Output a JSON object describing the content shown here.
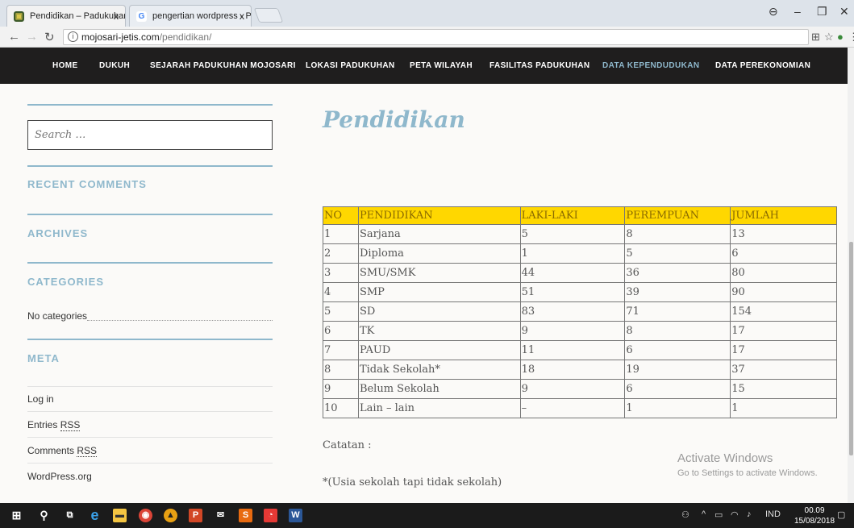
{
  "browser": {
    "tabs": [
      {
        "title": "Pendidikan – Padukuhan",
        "close": "x"
      },
      {
        "title": "pengertian wordpress - P",
        "close": "x"
      }
    ],
    "url_host": "mojosari-jetis.com",
    "url_path": "/pendidikan/"
  },
  "nav": {
    "items": [
      "HOME",
      "DUKUH",
      "SEJARAH PADUKUHAN MOJOSARI",
      "LOKASI PADUKUHAN",
      "PETA WILAYAH",
      "FASILITAS PADUKUHAN",
      "DATA KEPENDUDUKAN",
      "DATA PEREKONOMIAN"
    ],
    "current": "DATA KEPENDUDUKAN"
  },
  "sidebar": {
    "search_placeholder": "Search …",
    "recent_comments_title": "RECENT COMMENTS",
    "archives_title": "ARCHIVES",
    "categories_title": "CATEGORIES",
    "categories_empty": "No categories",
    "meta_title": "META",
    "meta_login": "Log in",
    "meta_entries_prefix": "Entries ",
    "meta_comments_prefix": "Comments ",
    "meta_rss": "RSS",
    "meta_wordpress": "WordPress.org"
  },
  "page": {
    "title": "Pendidikan",
    "table": {
      "headers": [
        "NO",
        "PENDIDIKAN",
        "LAKI-LAKI",
        "PEREMPUAN",
        "JUMLAH"
      ],
      "rows": [
        [
          "1",
          "Sarjana",
          "5",
          "8",
          "13"
        ],
        [
          "2",
          "Diploma",
          "1",
          "5",
          "6"
        ],
        [
          "3",
          "SMU/SMK",
          "44",
          "36",
          "80"
        ],
        [
          "4",
          "SMP",
          "51",
          "39",
          "90"
        ],
        [
          "5",
          "SD",
          "83",
          "71",
          "154"
        ],
        [
          "6",
          "TK",
          "9",
          "8",
          "17"
        ],
        [
          "7",
          "PAUD",
          "11",
          "6",
          "17"
        ],
        [
          "8",
          "Tidak Sekolah*",
          "18",
          "19",
          "37"
        ],
        [
          "9",
          "Belum Sekolah",
          "9",
          "6",
          "15"
        ],
        [
          "10",
          "Lain – lain",
          "–",
          "1",
          "1"
        ]
      ]
    },
    "note_label": "Catatan :",
    "note_text": "*(Usia sekolah tapi tidak sekolah)"
  },
  "watermark": {
    "line1": "Activate Windows",
    "line2": "Go to Settings to activate Windows."
  },
  "taskbar": {
    "lang": "IND",
    "time": "00.09",
    "date": "15/08/2018"
  }
}
